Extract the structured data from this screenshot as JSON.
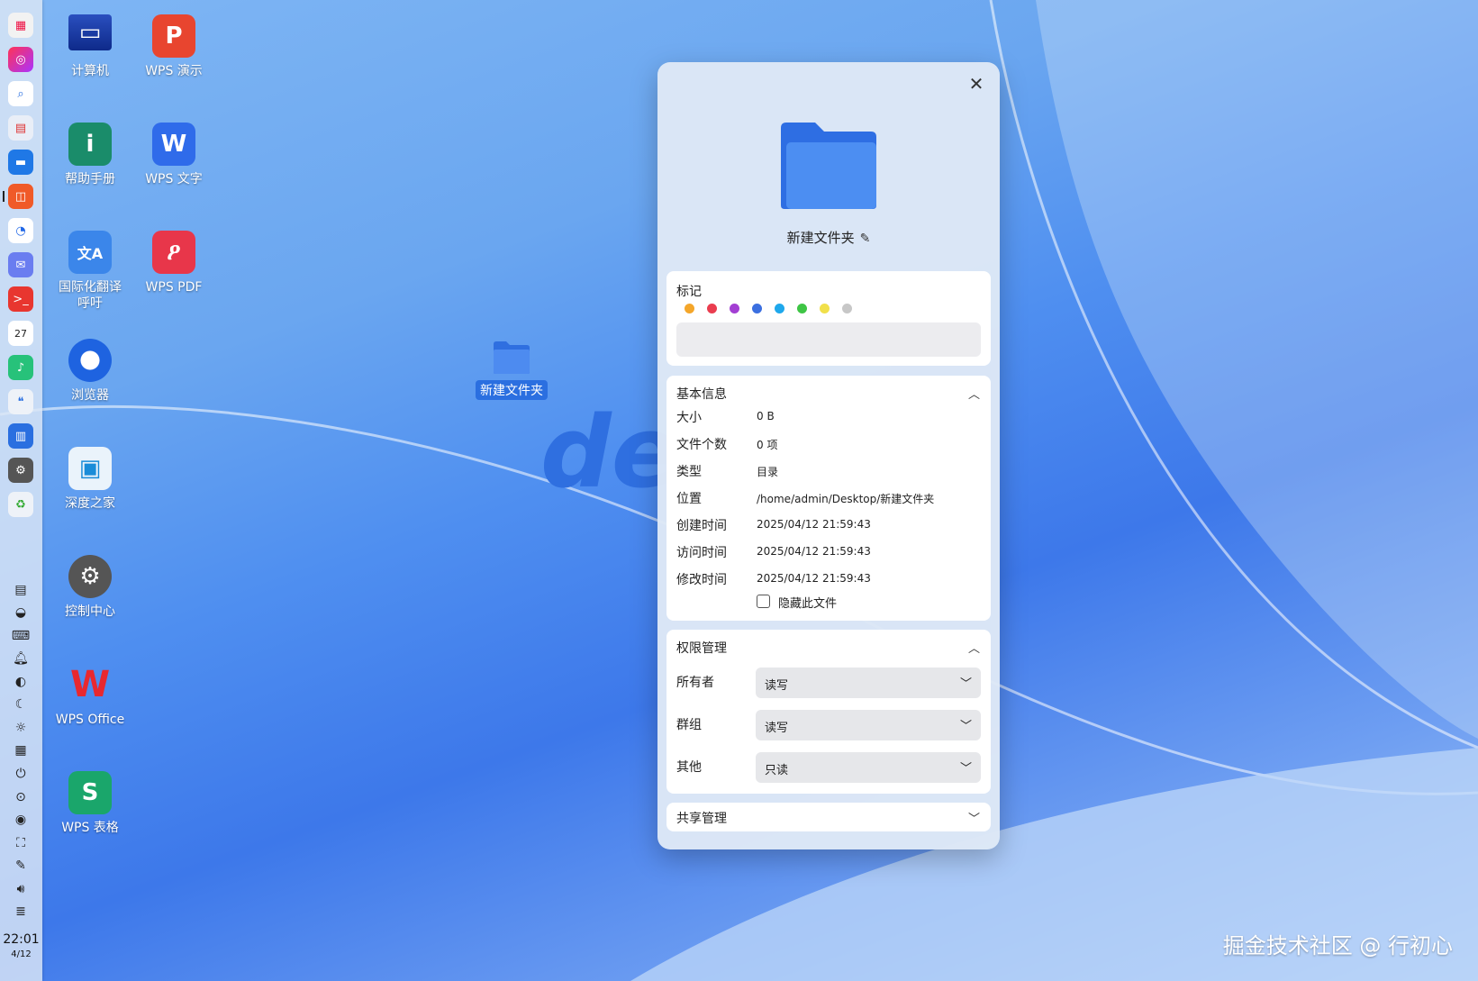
{
  "desktop": {
    "icons": [
      {
        "label": "计算机",
        "icon": "computer-icon"
      },
      {
        "label": "WPS 演示",
        "icon": "wps-presentation-icon",
        "glyph": "P"
      },
      {
        "label": "帮助手册",
        "icon": "help-manual-icon"
      },
      {
        "label": "WPS 文字",
        "icon": "wps-writer-icon",
        "glyph": "W"
      },
      {
        "label": "国际化翻译呼吁",
        "icon": "translate-icon"
      },
      {
        "label": "WPS PDF",
        "icon": "wps-pdf-icon"
      },
      {
        "label": "浏览器",
        "icon": "browser-icon"
      },
      {
        "label": "深度之家",
        "icon": "deepin-home-icon"
      },
      {
        "label": "控制中心",
        "icon": "control-center-icon"
      },
      {
        "label": "WPS Office",
        "icon": "wps-office-icon"
      },
      {
        "label": "WPS 表格",
        "icon": "wps-spreadsheet-icon",
        "glyph": "S"
      }
    ],
    "selected_folder_label": "新建文件夹",
    "watermark": "掘金技术社区 @ 行初心"
  },
  "dock": {
    "calendar_day": "27",
    "time": "22:01",
    "date": "4/12"
  },
  "dialog": {
    "file_name": "新建文件夹",
    "tags": {
      "title": "标记",
      "colors": [
        "#f4a62a",
        "#ea3d4f",
        "#a33fd3",
        "#3b6fe0",
        "#1fa8ec",
        "#3ec545",
        "#f1e04a",
        "#c7c7c7"
      ]
    },
    "basic": {
      "title": "基本信息",
      "rows": [
        {
          "key": "大小",
          "value": "0 B"
        },
        {
          "key": "文件个数",
          "value": "0 项"
        },
        {
          "key": "类型",
          "value": "目录"
        },
        {
          "key": "位置",
          "value": "/home/admin/Desktop/新建文件夹"
        },
        {
          "key": "创建时间",
          "value": "2025/04/12 21:59:43"
        },
        {
          "key": "访问时间",
          "value": "2025/04/12 21:59:43"
        },
        {
          "key": "修改时间",
          "value": "2025/04/12 21:59:43"
        }
      ],
      "hide_checkbox_label": "隐藏此文件",
      "hide_checked": false
    },
    "permissions": {
      "title": "权限管理",
      "rows": [
        {
          "key": "所有者",
          "value": "读写"
        },
        {
          "key": "群组",
          "value": "读写"
        },
        {
          "key": "其他",
          "value": "只读"
        }
      ]
    },
    "sharing": {
      "title": "共享管理"
    }
  }
}
